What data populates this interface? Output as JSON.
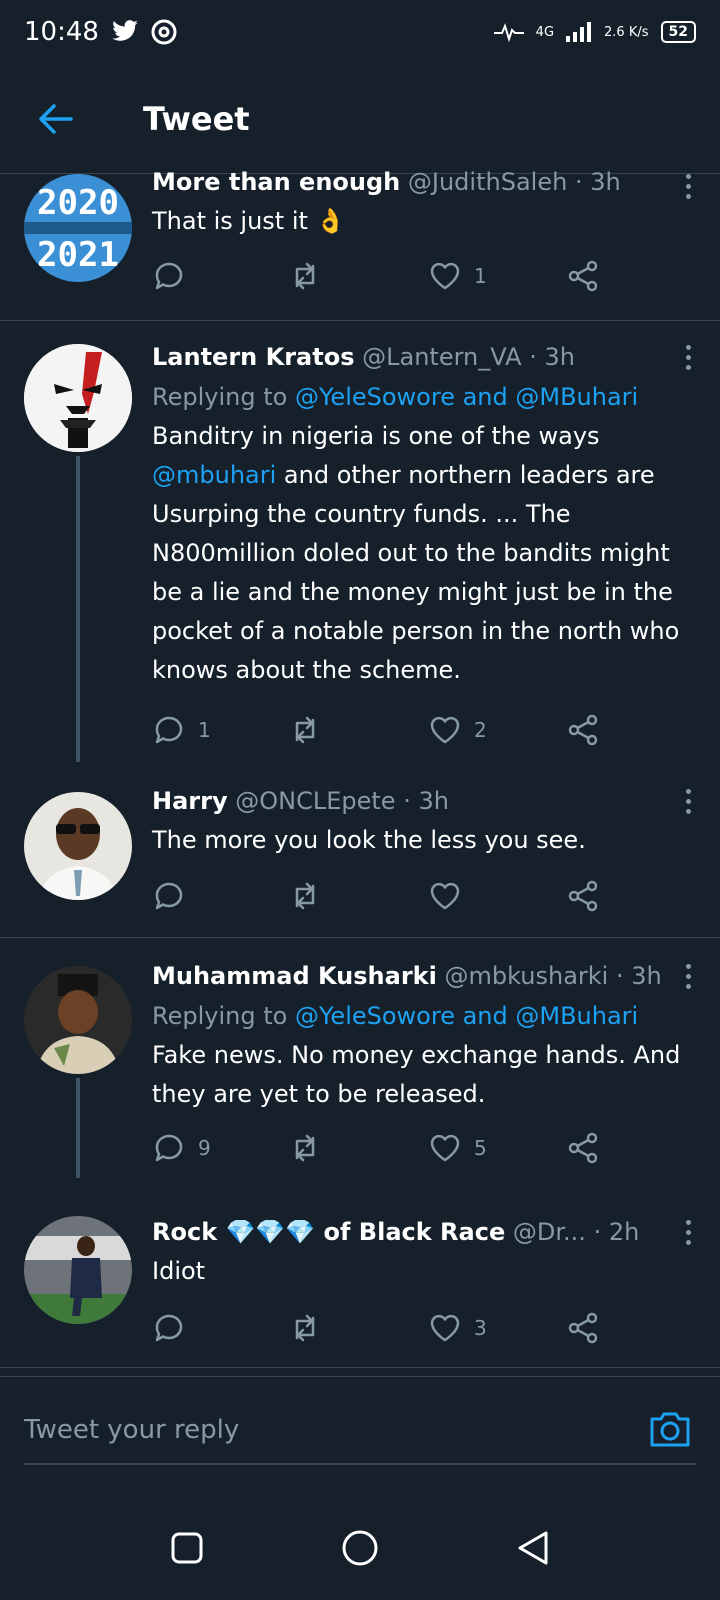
{
  "status_bar": {
    "time": "10:48",
    "network": "4G",
    "speed": "2.6 K/s",
    "battery": "52"
  },
  "header": {
    "title": "Tweet"
  },
  "colors": {
    "background": "#15202b",
    "accent": "#1da1f2",
    "muted": "#8899a6",
    "divider": "#38444d"
  },
  "tweets": [
    {
      "name": "More than enough",
      "handle": "@JudithSaleh",
      "time": "3h",
      "text": "That is just it 👌",
      "reply_to": "",
      "reply_count": "",
      "retweet_count": "",
      "like_count": "1"
    },
    {
      "name": "Lantern Kratos",
      "handle": "@Lantern_VA",
      "time": "3h",
      "reply_prefix": "Replying to",
      "reply_to": "@YeleSowore and @MBuhari",
      "text_before": "Banditry in nigeria is one of the ways",
      "text_mention": "@mbuhari",
      "text_after": "and other northern leaders are Usurping the country funds. ... The N800million doled out to the bandits might be a lie and the money might just be in the pocket of a notable person in the north who knows about the scheme.",
      "reply_count": "1",
      "retweet_count": "",
      "like_count": "2"
    },
    {
      "name": "Harry",
      "handle": "@ONCLEpete",
      "time": "3h",
      "text": "The more you look the less you see.",
      "reply_count": "",
      "retweet_count": "",
      "like_count": ""
    },
    {
      "name": "Muhammad Kusharki",
      "handle": "@mbkusharki",
      "time": "3h",
      "reply_prefix": "Replying to",
      "reply_to": "@YeleSowore and @MBuhari",
      "text": "Fake news. No money exchange hands. And they are yet to be released.",
      "reply_count": "9",
      "retweet_count": "",
      "like_count": "5"
    },
    {
      "name": "Rock 💎💎💎 of Black Race",
      "handle": "@Dr...",
      "time": "2h",
      "text": "Idiot",
      "reply_count": "",
      "retweet_count": "",
      "like_count": "3"
    }
  ],
  "reply_bar": {
    "placeholder": "Tweet your reply"
  },
  "icons": [
    "back-arrow-icon",
    "more-icon",
    "reply-icon",
    "retweet-icon",
    "like-icon",
    "share-icon",
    "camera-icon",
    "recents-icon",
    "home-icon",
    "back-icon"
  ]
}
